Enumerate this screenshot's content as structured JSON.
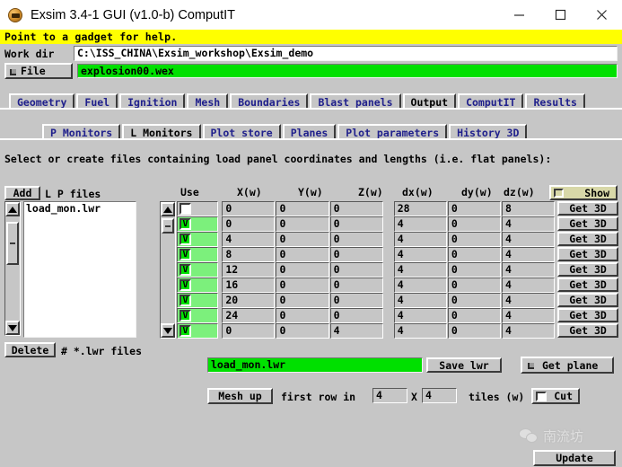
{
  "window": {
    "title": "Exsim 3.4-1 GUI (v1.0-b) ComputIT",
    "icon": "exsim-app-icon",
    "minimize_label": "minimize-icon",
    "maximize_label": "maximize-icon",
    "close_label": "close-icon"
  },
  "help": {
    "message": "Point to a gadget for help."
  },
  "workdir": {
    "label": "Work dir",
    "value": "C:\\ISS_CHINA\\Exsim_workshop\\Exsim_demo",
    "placeholder": ""
  },
  "file": {
    "button_label": "File",
    "value": "explosion00.wex",
    "placeholder": ""
  },
  "tabs_primary": [
    {
      "label": "Geometry",
      "selected": false
    },
    {
      "label": "Fuel",
      "selected": false
    },
    {
      "label": "Ignition",
      "selected": false
    },
    {
      "label": "Mesh",
      "selected": false
    },
    {
      "label": "Boundaries",
      "selected": false
    },
    {
      "label": "Blast panels",
      "selected": false
    },
    {
      "label": "Output",
      "selected": true
    },
    {
      "label": "ComputIT",
      "selected": false
    },
    {
      "label": "Results",
      "selected": false
    }
  ],
  "tabs_secondary": [
    {
      "label": "P Monitors",
      "selected": false
    },
    {
      "label": "L Monitors",
      "selected": true
    },
    {
      "label": "Plot store",
      "selected": false
    },
    {
      "label": "Planes",
      "selected": false
    },
    {
      "label": "Plot parameters",
      "selected": false
    },
    {
      "label": "History 3D",
      "selected": false
    }
  ],
  "instruction": "Select or create files containing load panel coordinates and lengths (i.e. flat panels):",
  "file_panel": {
    "add_label": "Add",
    "lp_files_label": "L P files",
    "items": [
      "load_mon.lwr"
    ],
    "delete_label": "Delete",
    "count_label": "# *.lwr files"
  },
  "table": {
    "headers": [
      "Use",
      "X(w)",
      "Y(w)",
      "Z(w)",
      "dx(w)",
      "dy(w)",
      "dz(w)"
    ],
    "show_label": "Show",
    "show_checked": false,
    "get3d_label": "Get 3D",
    "rows": [
      {
        "use": false,
        "x": "0",
        "y": "0",
        "z": "0",
        "dx": "28",
        "dy": "0",
        "dz": "8"
      },
      {
        "use": true,
        "x": "0",
        "y": "0",
        "z": "0",
        "dx": "4",
        "dy": "0",
        "dz": "4"
      },
      {
        "use": true,
        "x": "4",
        "y": "0",
        "z": "0",
        "dx": "4",
        "dy": "0",
        "dz": "4"
      },
      {
        "use": true,
        "x": "8",
        "y": "0",
        "z": "0",
        "dx": "4",
        "dy": "0",
        "dz": "4"
      },
      {
        "use": true,
        "x": "12",
        "y": "0",
        "z": "0",
        "dx": "4",
        "dy": "0",
        "dz": "4"
      },
      {
        "use": true,
        "x": "16",
        "y": "0",
        "z": "0",
        "dx": "4",
        "dy": "0",
        "dz": "4"
      },
      {
        "use": true,
        "x": "20",
        "y": "0",
        "z": "0",
        "dx": "4",
        "dy": "0",
        "dz": "4"
      },
      {
        "use": true,
        "x": "24",
        "y": "0",
        "z": "0",
        "dx": "4",
        "dy": "0",
        "dz": "4"
      },
      {
        "use": true,
        "x": "0",
        "y": "0",
        "z": "4",
        "dx": "4",
        "dy": "0",
        "dz": "4"
      }
    ],
    "checkbox_mark": "V"
  },
  "save_row": {
    "filename_value": "load_mon.lwr",
    "filename_placeholder": "",
    "save_label": "Save lwr",
    "get_plane_label": "Get plane"
  },
  "mesh_row": {
    "mesh_up_label": "Mesh up",
    "first_row_label": "first row in",
    "rows_value": "4",
    "x_separator": "X",
    "cols_value": "4",
    "tiles_label": "tiles (w)",
    "cut_label": "Cut",
    "cut_checked": false
  },
  "watermark": {
    "text": "南流坊",
    "logo": "wechat-logo-icon"
  },
  "footer": {
    "update_label": "Update"
  },
  "colors": {
    "face": "#c6c6c6",
    "help_bg": "#ffff00",
    "green_field": "#00e000",
    "tab_text": "#20208c",
    "show_bg": "#d8d8a8"
  }
}
